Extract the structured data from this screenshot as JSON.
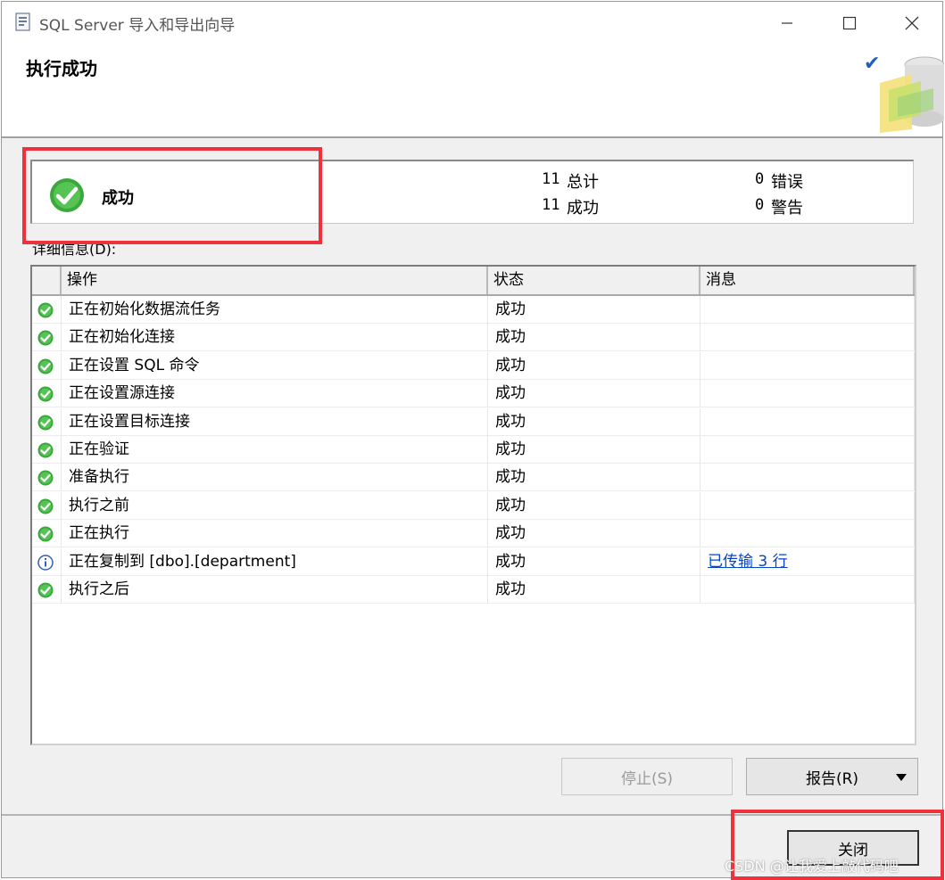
{
  "window": {
    "title": "SQL Server 导入和导出向导"
  },
  "header": {
    "title": "执行成功"
  },
  "summary": {
    "status": "成功",
    "total_count": "11",
    "total_label": "总计",
    "success_count": "11",
    "success_label": "成功",
    "error_count": "0",
    "error_label": "错误",
    "warning_count": "0",
    "warning_label": "警告"
  },
  "details": {
    "label": "详细信息(D):",
    "columns": [
      "操作",
      "状态",
      "消息"
    ],
    "rows": [
      {
        "icon": "success-icon",
        "action": "正在初始化数据流任务",
        "status": "成功",
        "message": ""
      },
      {
        "icon": "success-icon",
        "action": "正在初始化连接",
        "status": "成功",
        "message": ""
      },
      {
        "icon": "success-icon",
        "action": "正在设置 SQL 命令",
        "status": "成功",
        "message": ""
      },
      {
        "icon": "success-icon",
        "action": "正在设置源连接",
        "status": "成功",
        "message": ""
      },
      {
        "icon": "success-icon",
        "action": "正在设置目标连接",
        "status": "成功",
        "message": ""
      },
      {
        "icon": "success-icon",
        "action": "正在验证",
        "status": "成功",
        "message": ""
      },
      {
        "icon": "success-icon",
        "action": "准备执行",
        "status": "成功",
        "message": ""
      },
      {
        "icon": "success-icon",
        "action": "执行之前",
        "status": "成功",
        "message": ""
      },
      {
        "icon": "success-icon",
        "action": "正在执行",
        "status": "成功",
        "message": ""
      },
      {
        "icon": "info-icon",
        "action": "正在复制到 [dbo].[department]",
        "status": "成功",
        "message": "已传输 3 行"
      },
      {
        "icon": "success-icon",
        "action": "执行之后",
        "status": "成功",
        "message": ""
      }
    ]
  },
  "buttons": {
    "stop": "停止(S)",
    "report": "报告(R)",
    "close": "关闭"
  },
  "watermark": "CSDN @让我爱上敲代码吧",
  "colors": {
    "highlight_box": "#f0303a",
    "success_green": "#3aa83a",
    "link": "#0645c8"
  }
}
